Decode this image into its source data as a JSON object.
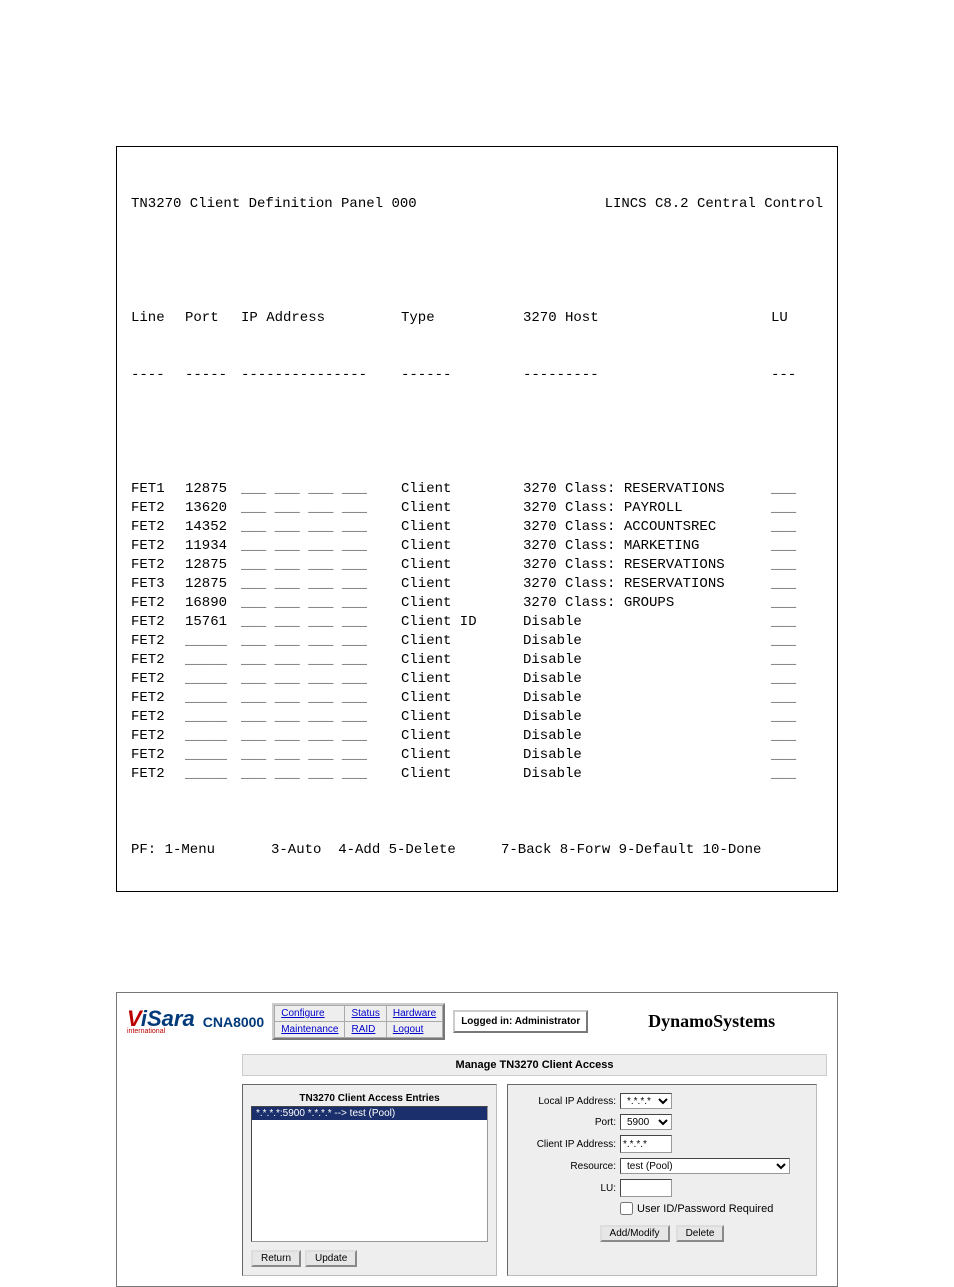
{
  "terminal": {
    "title_left": "TN3270 Client Definition Panel 000",
    "title_right": "LINCS C8.2 Central Control",
    "headers": {
      "line": "Line",
      "port": "Port",
      "ip": "IP Address",
      "type": "Type",
      "host": "3270 Host",
      "lu": "LU"
    },
    "dashes": {
      "line": "----",
      "port": "-----",
      "ip": "---------------",
      "type": "------",
      "host": "---------",
      "lu": "---"
    },
    "ip_blank": "___ ___ ___ ___",
    "port_blank": "_____",
    "lu_blank": "___",
    "rows": [
      {
        "line": "FET1",
        "port": "12875",
        "type": "Client",
        "host": "3270 Class: RESERVATIONS"
      },
      {
        "line": "FET2",
        "port": "13620",
        "type": "Client",
        "host": "3270 Class: PAYROLL"
      },
      {
        "line": "FET2",
        "port": "14352",
        "type": "Client",
        "host": "3270 Class: ACCOUNTSREC"
      },
      {
        "line": "FET2",
        "port": "11934",
        "type": "Client",
        "host": "3270 Class: MARKETING"
      },
      {
        "line": "FET2",
        "port": "12875",
        "type": "Client",
        "host": "3270 Class: RESERVATIONS"
      },
      {
        "line": "FET3",
        "port": "12875",
        "type": "Client",
        "host": "3270 Class: RESERVATIONS"
      },
      {
        "line": "FET2",
        "port": "16890",
        "type": "Client",
        "host": "3270 Class: GROUPS"
      },
      {
        "line": "FET2",
        "port": "15761",
        "type": "Client ID",
        "host": "Disable"
      },
      {
        "line": "FET2",
        "port": "",
        "type": "Client",
        "host": "Disable"
      },
      {
        "line": "FET2",
        "port": "",
        "type": "Client",
        "host": "Disable"
      },
      {
        "line": "FET2",
        "port": "",
        "type": "Client",
        "host": "Disable"
      },
      {
        "line": "FET2",
        "port": "",
        "type": "Client",
        "host": "Disable"
      },
      {
        "line": "FET2",
        "port": "",
        "type": "Client",
        "host": "Disable"
      },
      {
        "line": "FET2",
        "port": "",
        "type": "Client",
        "host": "Disable"
      },
      {
        "line": "FET2",
        "port": "",
        "type": "Client",
        "host": "Disable"
      },
      {
        "line": "FET2",
        "port": "",
        "type": "Client",
        "host": "Disable"
      }
    ],
    "footer_left": "PF: 1-Menu",
    "footer_mid": "3-Auto  4-Add 5-Delete",
    "footer_right": "7-Back 8-Forw 9-Default 10-Done"
  },
  "web": {
    "logo": "Visara",
    "logo_sub": "international",
    "model": "CNA8000",
    "nav": {
      "configure": "Configure",
      "status": "Status",
      "hardware": "Hardware",
      "maintenance": "Maintenance",
      "raid": "RAID",
      "logout": "Logout"
    },
    "logged_in": "Logged in: Administrator",
    "company": "DynamoSystems",
    "manage_title": "Manage TN3270 Client Access",
    "entries_title": "TN3270 Client Access Entries",
    "entry_selected": "*.*.*.*:5900 *.*.*.* --> test (Pool)",
    "buttons": {
      "return": "Return",
      "update": "Update",
      "add_modify": "Add/Modify",
      "delete": "Delete"
    },
    "form": {
      "local_ip_label": "Local IP Address:",
      "local_ip_value": "*.*.*.*",
      "port_label": "Port:",
      "port_value": "5900",
      "client_ip_label": "Client IP Address:",
      "client_ip_value": "*.*.*.*",
      "resource_label": "Resource:",
      "resource_value": "test (Pool)",
      "lu_label": "LU:",
      "lu_value": "",
      "uidpw_label": "User ID/Password Required"
    }
  }
}
